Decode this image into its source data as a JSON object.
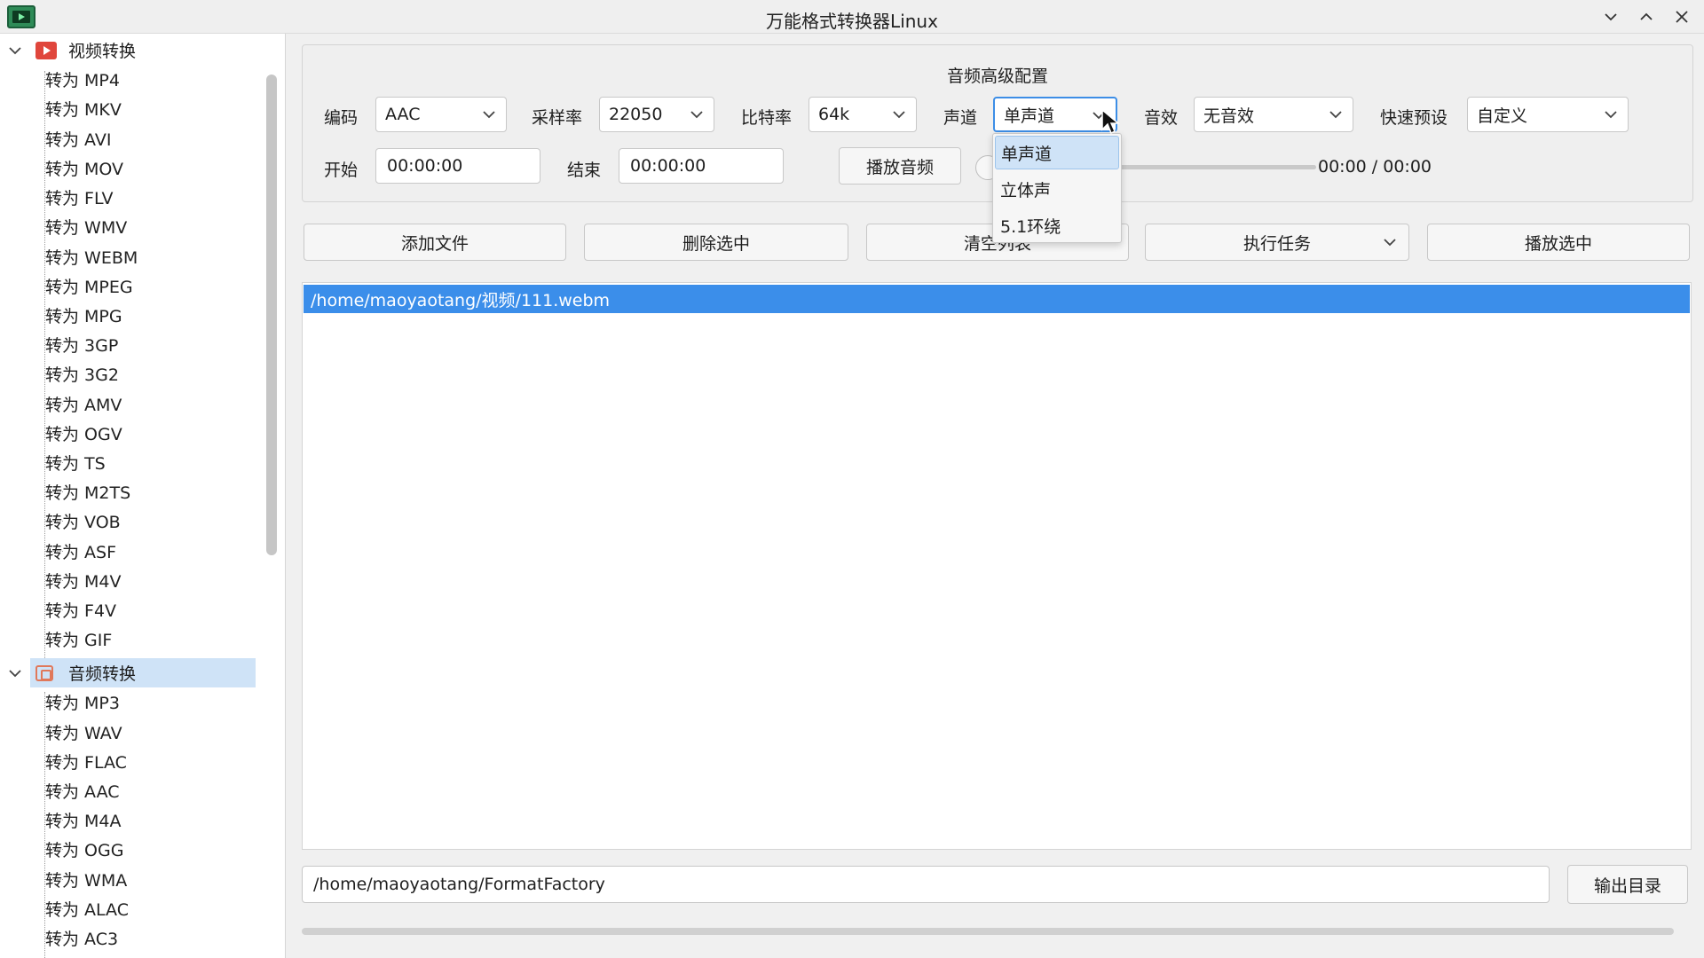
{
  "window": {
    "title": "万能格式转换器Linux",
    "icons": [
      "app-icon",
      "minimize-icon",
      "maximize-icon",
      "close-icon"
    ]
  },
  "sidebar": {
    "video_category": {
      "label": "视频转换",
      "expanded": true,
      "icon": "video-icon"
    },
    "video_items": [
      "转为 MP4",
      "转为 MKV",
      "转为 AVI",
      "转为 MOV",
      "转为 FLV",
      "转为 WMV",
      "转为 WEBM",
      "转为 MPEG",
      "转为 MPG",
      "转为 3GP",
      "转为 3G2",
      "转为 AMV",
      "转为 OGV",
      "转为 TS",
      "转为 M2TS",
      "转为 VOB",
      "转为 ASF",
      "转为 M4V",
      "转为 F4V",
      "转为 GIF"
    ],
    "audio_category": {
      "label": "音频转换",
      "expanded": true,
      "selected": true,
      "icon": "audio-icon"
    },
    "audio_items": [
      "转为 MP3",
      "转为 WAV",
      "转为 FLAC",
      "转为 AAC",
      "转为 M4A",
      "转为 OGG",
      "转为 WMA",
      "转为 ALAC",
      "转为 AC3"
    ]
  },
  "config": {
    "title": "音频高级配置",
    "codec": {
      "label": "编码",
      "value": "AAC"
    },
    "sample_rate": {
      "label": "采样率",
      "value": "22050"
    },
    "bitrate": {
      "label": "比特率",
      "value": "64k"
    },
    "channel": {
      "label": "声道",
      "value": "单声道",
      "options": [
        "单声道",
        "立体声",
        "5.1环绕"
      ]
    },
    "effect": {
      "label": "音效",
      "value": "无音效"
    },
    "preset": {
      "label": "快速预设",
      "value": "自定义"
    },
    "start": {
      "label": "开始",
      "value": "00:00:00"
    },
    "end": {
      "label": "结束",
      "value": "00:00:00"
    },
    "play_audio": "播放音频",
    "time_readout": "00:00 / 00:00",
    "slider_progress": 0
  },
  "toolbar": {
    "add_files": "添加文件",
    "delete_selected": "删除选中",
    "clear_list": "清空列表",
    "run_task": "执行任务",
    "play_selected": "播放选中"
  },
  "file_list": {
    "items": [
      "/home/maoyaotang/视频/111.webm"
    ],
    "selected_index": 0
  },
  "output": {
    "path": "/home/maoyaotang/FormatFactory",
    "button": "输出目录"
  },
  "colors": {
    "selection": "#3b8eea",
    "tree_selection": "#cfe3f7",
    "focus_border": "#3d8ee6"
  }
}
